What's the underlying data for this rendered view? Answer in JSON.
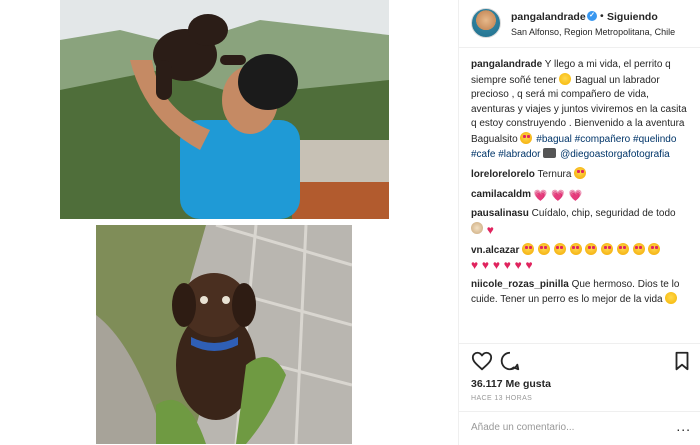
{
  "post": {
    "username": "pangalandrade",
    "follow_status": "Siguiendo",
    "location": "San Alfonso, Region Metropolitana, Chile",
    "caption_text_1": "Y llego a mi vida, el perrito q siempre soñé tener",
    "caption_text_2": "Bagual un labrador precioso , q será mi compañero de vida, aventuras y viajes y juntos viviremos en la casita q estoy construyendo . Bienvenido a la aventura Bagualsito",
    "hashtags": [
      "#bagual",
      "#compañero",
      "#quelindo",
      "#cafe",
      "#labrador"
    ],
    "mention": "@diegoastorgafotografia",
    "likes": "36.117 Me gusta",
    "time_ago": "HACE 13 HORAS"
  },
  "comments": [
    {
      "user": "lorelorelorelo",
      "text": "Ternura"
    },
    {
      "user": "camilacaldm",
      "text": ""
    },
    {
      "user": "pausalinasu",
      "text": "Cuídalo, chip, seguridad de todo"
    },
    {
      "user": "vn.alcazar",
      "text": ""
    },
    {
      "user": "niicole_rozas_pinilla",
      "text": "Que hermoso. Dios te lo cuide. Tener un perro es lo mejor de la vida"
    }
  ],
  "add_comment": {
    "placeholder": "Añade un comentario...",
    "more_label": "..."
  },
  "icons": {
    "like": "heart-outline-icon",
    "comment": "speech-bubble-icon",
    "save": "bookmark-icon",
    "verified": "verified-badge-icon"
  },
  "colors": {
    "hashtag": "#003569",
    "verified": "#3897f0",
    "heart": "#e0245e"
  }
}
